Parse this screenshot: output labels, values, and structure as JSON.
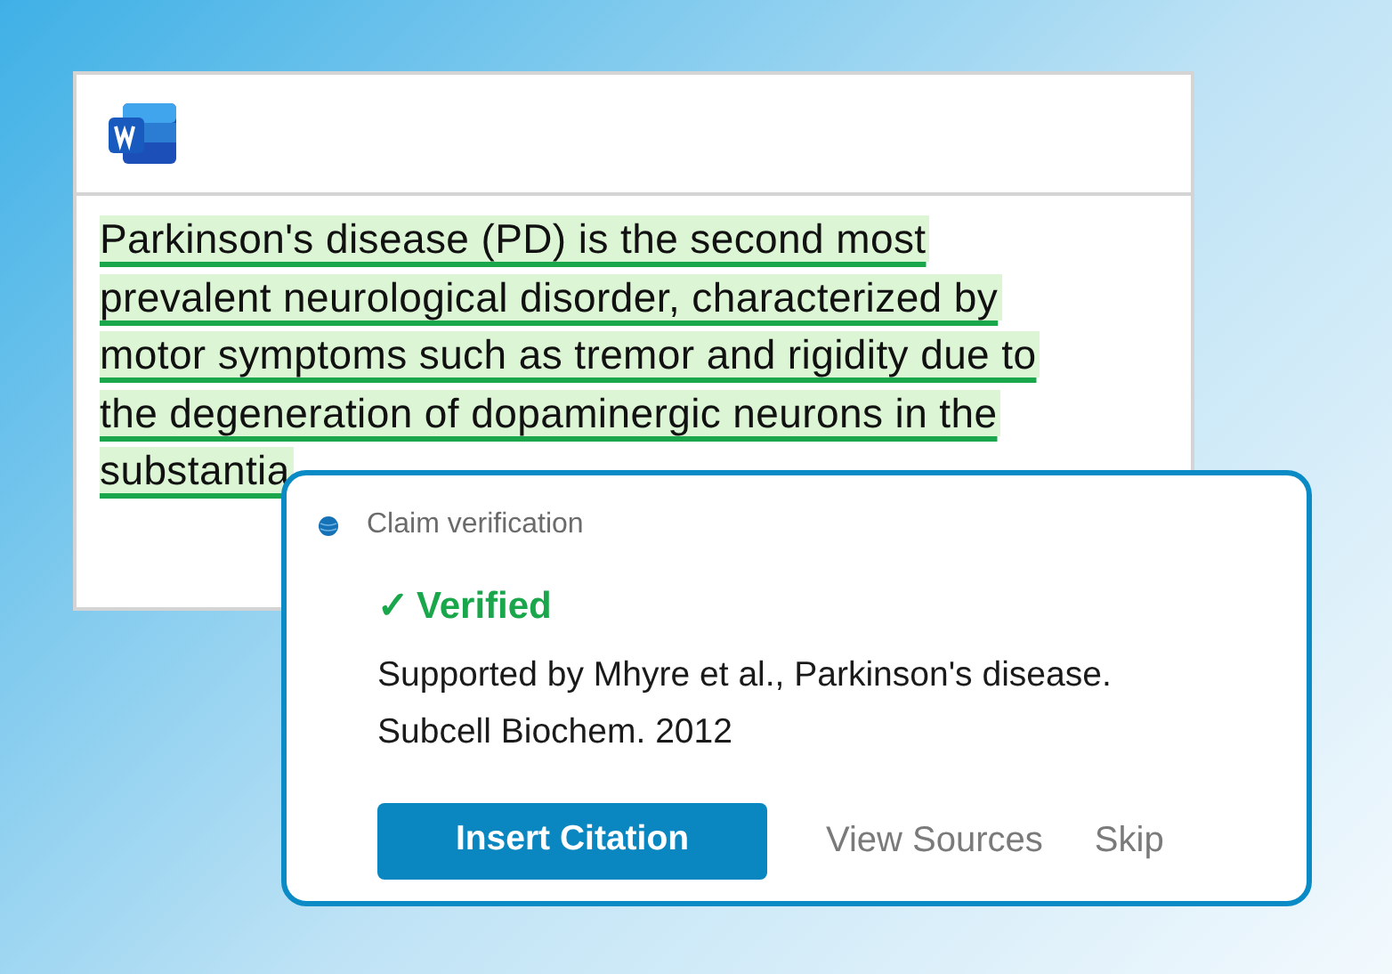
{
  "document": {
    "paragraph_lines": [
      "Parkinson's disease (PD) is the second most",
      "prevalent neurological disorder, characterized by",
      "motor symptoms such as tremor and rigidity due to",
      "the degeneration of dopaminergic neurons in the",
      "substantia"
    ]
  },
  "popup": {
    "title": "Claim verification",
    "status": {
      "kind": "verified",
      "icon": "✓",
      "label": "Verified"
    },
    "support_text": "Supported by Mhyre et al., Parkinson's disease. Subcell Biochem. 2012",
    "primary_button": "Insert Citation",
    "links": [
      "View Sources",
      "Skip"
    ]
  }
}
